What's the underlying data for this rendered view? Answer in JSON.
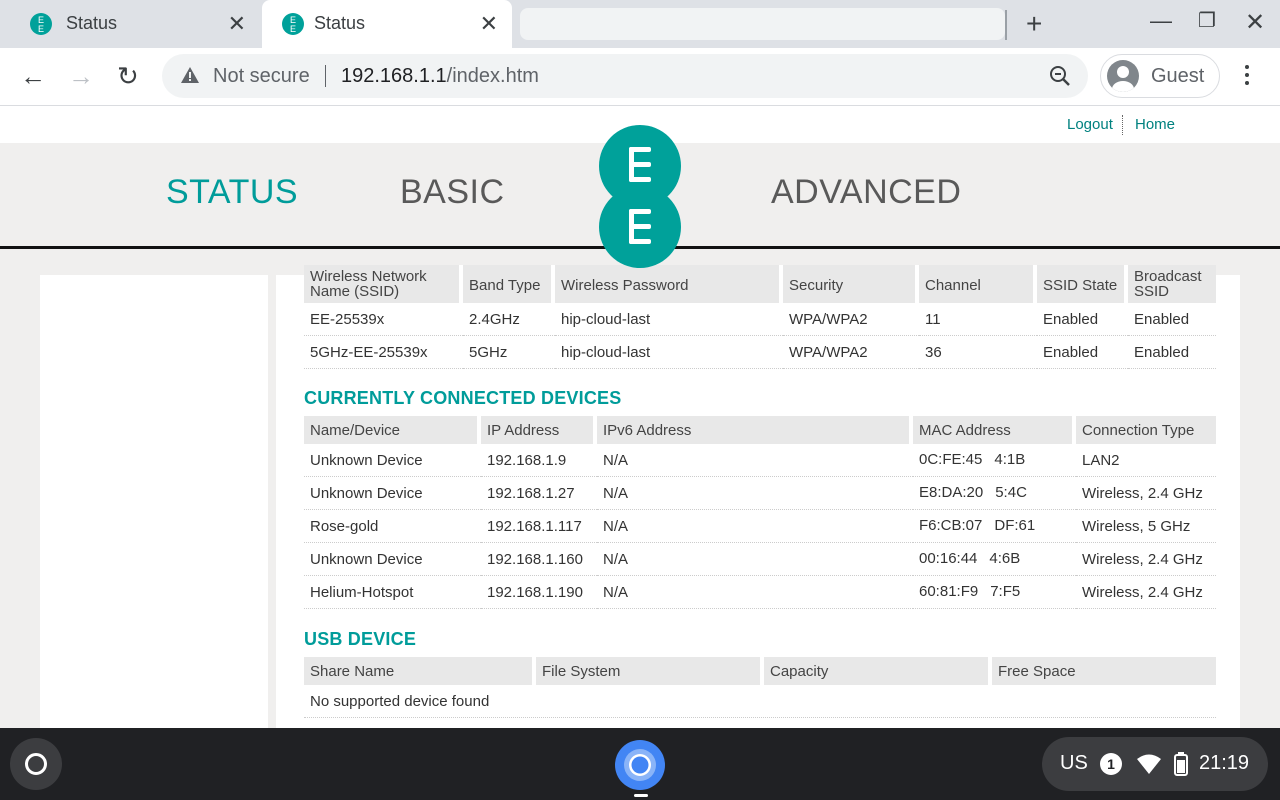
{
  "browser": {
    "tabs": [
      {
        "title": "Status",
        "active": false
      },
      {
        "title": "Status",
        "active": true
      }
    ],
    "security_label": "Not secure",
    "url_host": "192.168.1.1",
    "url_path": "/index.htm",
    "profile_name": "Guest"
  },
  "page": {
    "top_links": {
      "logout": "Logout",
      "home": "Home"
    },
    "nav": {
      "status": "STATUS",
      "basic": "BASIC",
      "advanced": "ADVANCED"
    },
    "colors": {
      "accent": "#009c9a",
      "logo": "#00a19a"
    },
    "wireless": {
      "headers": [
        "Wireless Network Name (SSID)",
        "Band Type",
        "Wireless Password",
        "Security",
        "Channel",
        "SSID State",
        "Broadcast SSID"
      ],
      "rows": [
        [
          "EE-25539x",
          "2.4GHz",
          "hip-cloud-last",
          "WPA/WPA2",
          "11",
          "Enabled",
          "Enabled"
        ],
        [
          "5GHz-EE-25539x",
          "5GHz",
          "hip-cloud-last",
          "WPA/WPA2",
          "36",
          "Enabled",
          "Enabled"
        ]
      ]
    },
    "devices": {
      "heading": "CURRENTLY CONNECTED DEVICES",
      "headers": [
        "Name/Device",
        "IP Address",
        "IPv6 Address",
        "MAC Address",
        "Connection Type"
      ],
      "rows": [
        {
          "name": "Unknown Device",
          "ip": "192.168.1.9",
          "ipv6": "N/A",
          "mac_a": "0C:FE:45",
          "mac_b": "4:1B",
          "conn": "LAN2"
        },
        {
          "name": "Unknown Device",
          "ip": "192.168.1.27",
          "ipv6": "N/A",
          "mac_a": "E8:DA:20",
          "mac_b": "5:4C",
          "conn": "Wireless, 2.4 GHz"
        },
        {
          "name": "Rose-gold",
          "ip": "192.168.1.117",
          "ipv6": "N/A",
          "mac_a": "F6:CB:07",
          "mac_b": "DF:61",
          "conn": "Wireless, 5 GHz"
        },
        {
          "name": "Unknown Device",
          "ip": "192.168.1.160",
          "ipv6": "N/A",
          "mac_a": "00:16:44",
          "mac_b": "4:6B",
          "conn": "Wireless, 2.4 GHz"
        },
        {
          "name": "Helium-Hotspot",
          "ip": "192.168.1.190",
          "ipv6": "N/A",
          "mac_a": "60:81:F9",
          "mac_b": "7:F5",
          "conn": "Wireless, 2.4 GHz"
        }
      ]
    },
    "usb": {
      "heading": "USB DEVICE",
      "headers": [
        "Share Name",
        "File System",
        "Capacity",
        "Free Space"
      ],
      "empty_message": "No supported device found"
    }
  },
  "shelf": {
    "ime": "US",
    "notification_count": "1",
    "time": "21:19"
  }
}
